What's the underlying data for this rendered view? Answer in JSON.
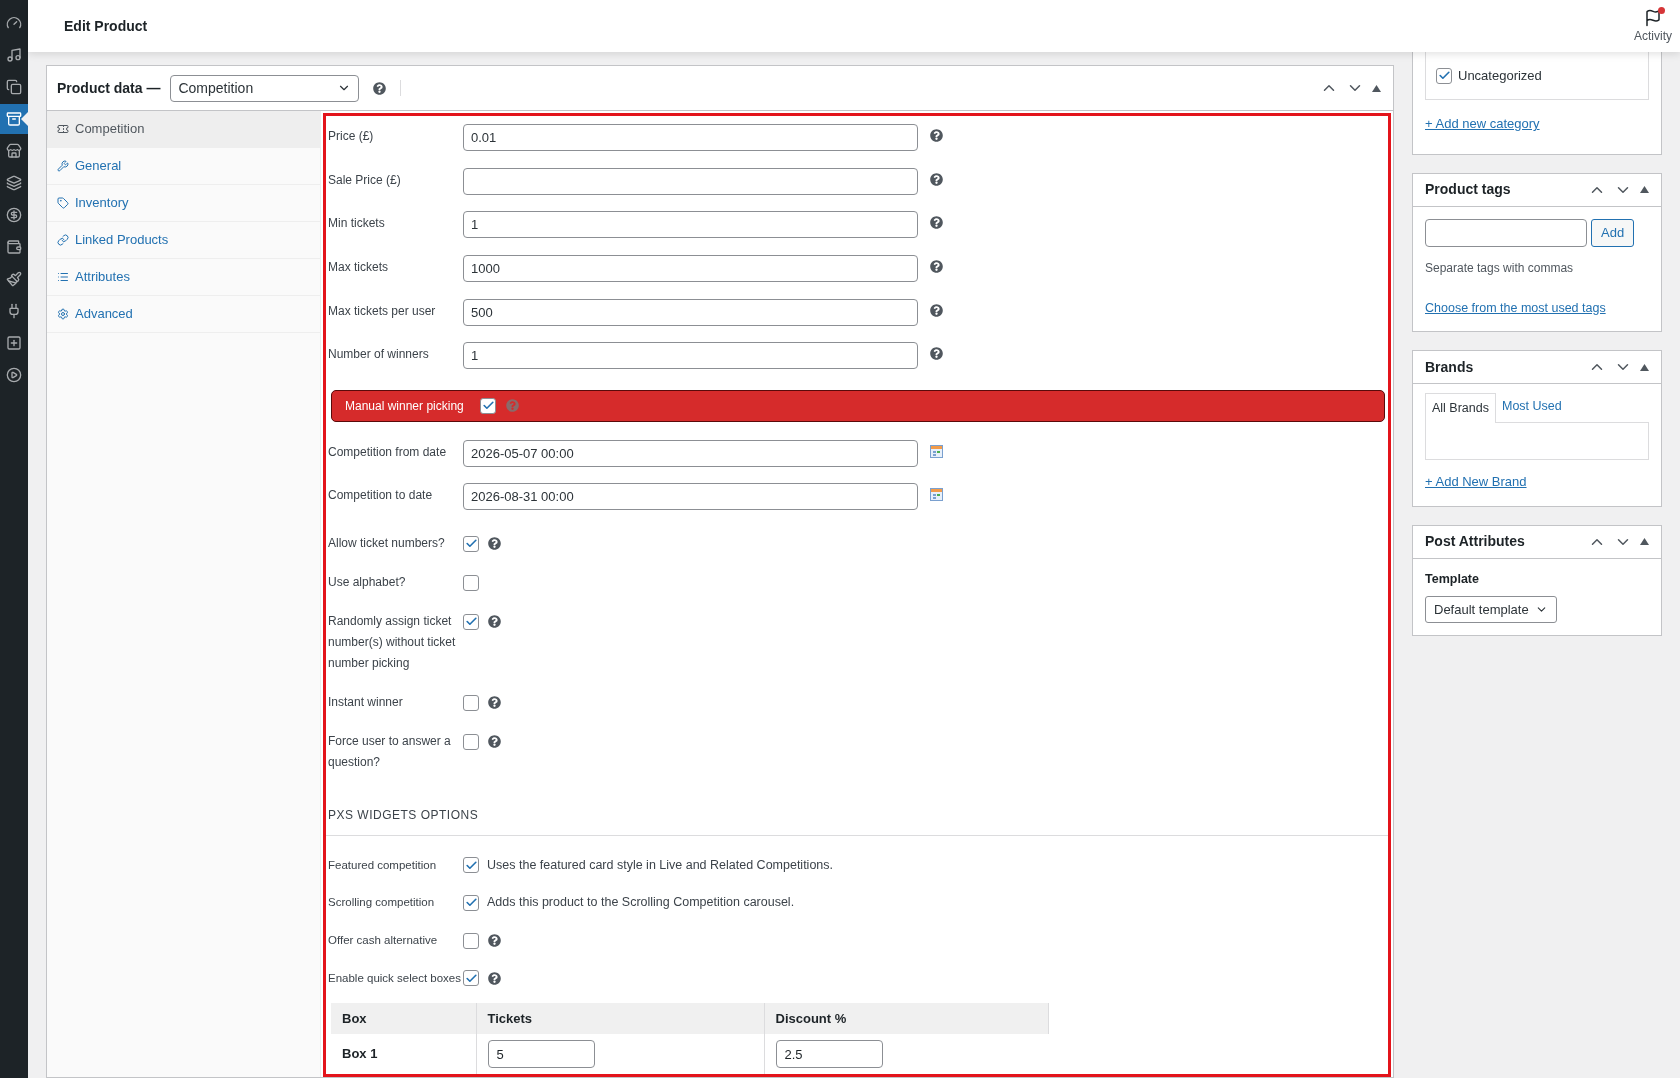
{
  "header": {
    "title": "Edit Product",
    "activity": "Activity",
    "activity_alert": true
  },
  "admin_menu": [
    {
      "kind": "gauge",
      "selected": false
    },
    {
      "kind": "media",
      "selected": false
    },
    {
      "kind": "pages",
      "selected": false
    },
    {
      "kind": "products",
      "selected": true
    },
    {
      "kind": "store",
      "selected": false
    },
    {
      "kind": "layers",
      "selected": false
    },
    {
      "kind": "dollar",
      "selected": false
    },
    {
      "kind": "wallet",
      "selected": false
    },
    {
      "kind": "brush",
      "selected": false
    },
    {
      "kind": "plug",
      "selected": false
    },
    {
      "kind": "plus",
      "selected": false
    },
    {
      "kind": "play",
      "selected": false
    }
  ],
  "product_data": {
    "label": "Product data —",
    "type": "Competition",
    "tabs": [
      {
        "kind": "ticket",
        "label": "Competition",
        "selected": true
      },
      {
        "kind": "wrench",
        "label": "General",
        "selected": false
      },
      {
        "kind": "tag",
        "label": "Inventory",
        "selected": false
      },
      {
        "kind": "link",
        "label": "Linked Products",
        "selected": false
      },
      {
        "kind": "list",
        "label": "Attributes",
        "selected": false
      },
      {
        "kind": "gear",
        "label": "Advanced",
        "selected": false
      }
    ]
  },
  "fields": [
    {
      "kind": "text",
      "label": "Price (£)",
      "value": "0.01",
      "help": true
    },
    {
      "kind": "text",
      "label": "Sale Price (£)",
      "help": true
    },
    {
      "kind": "text",
      "label": "Min tickets",
      "value": "1",
      "help": true
    },
    {
      "kind": "text",
      "label": "Max tickets",
      "value": "1000",
      "help": true
    },
    {
      "kind": "text",
      "label": "Max tickets per user",
      "value": "500",
      "help": true
    },
    {
      "kind": "text",
      "label": "Number of winners",
      "value": "1",
      "help": true
    },
    {
      "kind": "banner",
      "label": "Manual winner picking",
      "checked": true,
      "help": true
    },
    {
      "kind": "date",
      "label": "Competition from date",
      "value": "2026-05-07 00:00"
    },
    {
      "kind": "date",
      "label": "Competition to date",
      "value": "2026-08-31 00:00"
    },
    {
      "kind": "checkbox",
      "label": "Allow ticket numbers?",
      "checked": true,
      "help": true
    },
    {
      "kind": "checkbox",
      "label": "Use alphabet?",
      "checked": false,
      "help": false
    },
    {
      "kind": "checkbox",
      "label": "Randomly assign ticket number(s) without ticket number picking",
      "checked": true,
      "help": true
    },
    {
      "kind": "checkbox",
      "label": "Instant winner",
      "checked": false,
      "help": true
    },
    {
      "kind": "checkbox",
      "label": "Force user to answer a question?",
      "checked": false,
      "help": true
    }
  ],
  "widgets": {
    "heading": "PXS WIDGETS OPTIONS",
    "fields": [
      {
        "label": "Featured competition",
        "checked": true,
        "description": "Uses the featured card style in Live and Related Competitions.",
        "help": false
      },
      {
        "label": "Scrolling competition",
        "checked": true,
        "description": "Adds this product to the Scrolling Competition carousel.",
        "help": false
      },
      {
        "label": "Offer cash alternative",
        "checked": false,
        "help": true
      },
      {
        "label": "Enable quick select boxes",
        "checked": true,
        "help": true
      }
    ]
  },
  "quick_select": {
    "columns": [
      "Box",
      "Tickets",
      "Discount %"
    ],
    "rows": [
      {
        "box": "Box 1",
        "tickets": "5",
        "discount": "2.5"
      }
    ]
  },
  "sidebar": {
    "categories": {
      "items": [
        {
          "label": "Uncategorized",
          "checked": true
        }
      ],
      "add_link": "+ Add new category"
    },
    "product_tags": {
      "title": "Product tags",
      "button": "Add",
      "hint": "Separate tags with commas",
      "link": "Choose from the most used tags"
    },
    "brands": {
      "title": "Brands",
      "tabs": [
        {
          "label": "All Brands",
          "selected": true
        },
        {
          "label": "Most Used",
          "selected": false
        }
      ],
      "add_link": "+ Add New Brand"
    },
    "post_attributes": {
      "title": "Post Attributes",
      "template_label": "Template",
      "template": "Default template"
    }
  }
}
